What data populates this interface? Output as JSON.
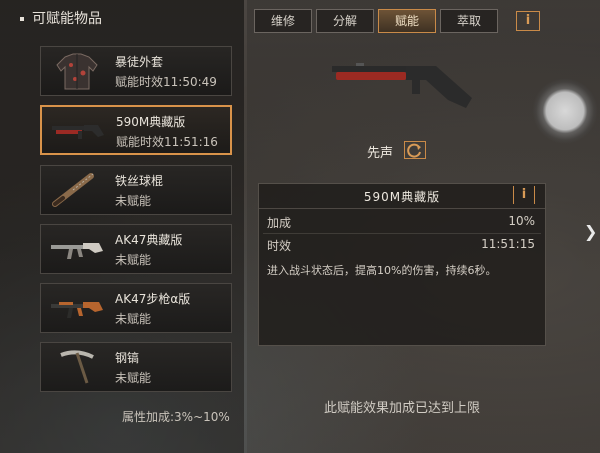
{
  "left_panel": {
    "title": "可赋能物品",
    "items": [
      {
        "name": "暴徒外套",
        "status": "赋能时效11:50:49",
        "icon": "jacket-icon",
        "selected": false
      },
      {
        "name": "590M典藏版",
        "status": "赋能时效11:51:16",
        "icon": "shotgun-icon",
        "selected": true
      },
      {
        "name": "铁丝球棍",
        "status": "未赋能",
        "icon": "bat-icon",
        "selected": false
      },
      {
        "name": "AK47典藏版",
        "status": "未赋能",
        "icon": "rifle-icon",
        "selected": false
      },
      {
        "name": "AK47步枪α版",
        "status": "未赋能",
        "icon": "rifle-icon",
        "selected": false
      },
      {
        "name": "钢镐",
        "status": "未赋能",
        "icon": "pickaxe-icon",
        "selected": false
      }
    ],
    "attr_bonus": "属性加成:3%~10%"
  },
  "tabs": [
    {
      "label": "维修",
      "active": false
    },
    {
      "label": "分解",
      "active": false
    },
    {
      "label": "赋能",
      "active": true
    },
    {
      "label": "萃取",
      "active": false
    }
  ],
  "info_button": "i",
  "selected_weapon": {
    "skill_name": "先声",
    "card": {
      "title": "590M典藏版",
      "bonus_label": "加成",
      "bonus_value": "10%",
      "duration_label": "时效",
      "duration_value": "11:51:15",
      "description": "进入战斗状态后，提高10%的伤害，持续6秒。"
    }
  },
  "limit_message": "此赋能效果加成已达到上限",
  "colors": {
    "accent": "#d9934a",
    "panel_dark": "#1e1c1a",
    "text": "#e8e3da"
  }
}
